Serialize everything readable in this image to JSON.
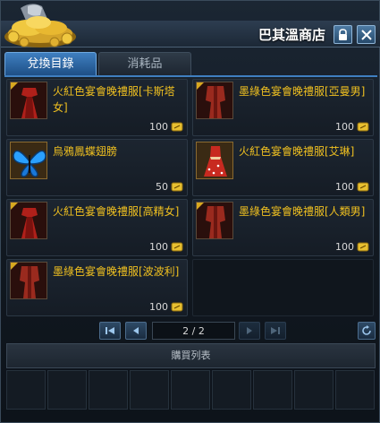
{
  "window": {
    "title": "巴其溫商店"
  },
  "tabs": [
    {
      "label": "兌換目錄",
      "active": true
    },
    {
      "label": "消耗品",
      "active": false
    }
  ],
  "items": [
    {
      "name": "火紅色宴會晚禮服[卡斯塔女]",
      "price": "100",
      "icon": "red-gown-icon",
      "color": "#b0201a"
    },
    {
      "name": "墨綠色宴會晚禮服[亞曼男]",
      "price": "100",
      "icon": "red-gown-icon",
      "color": "#9a2a1e"
    },
    {
      "name": "烏鴉鳳蝶翅膀",
      "price": "50",
      "icon": "butterfly-wings-icon",
      "color": "#2aa0ff"
    },
    {
      "name": "火紅色宴會晚禮服[艾琳]",
      "price": "100",
      "icon": "red-dress-icon",
      "color": "#c82a20"
    },
    {
      "name": "火紅色宴會晚禮服[高精女]",
      "price": "100",
      "icon": "red-gown-icon",
      "color": "#b0201a"
    },
    {
      "name": "墨綠色宴會晚禮服[人類男]",
      "price": "100",
      "icon": "red-gown-icon",
      "color": "#9a2a1e"
    },
    {
      "name": "墨綠色宴會晚禮服[波波利]",
      "price": "100",
      "icon": "red-gown-icon",
      "color": "#9a2a1e"
    }
  ],
  "pager": {
    "page_text": "2 / 2"
  },
  "buyback": {
    "label": "購買列表"
  },
  "colors": {
    "accent": "#3f7fc0",
    "item_name": "#f0c020"
  }
}
